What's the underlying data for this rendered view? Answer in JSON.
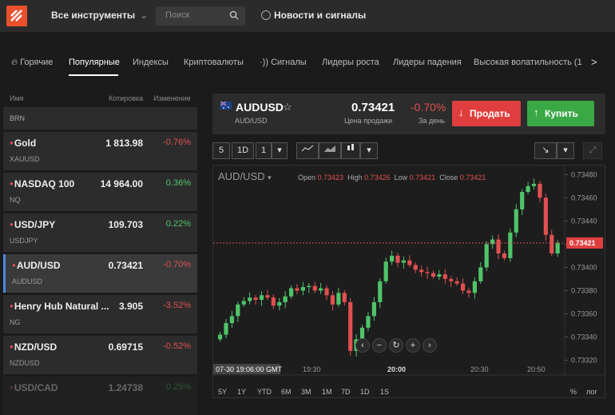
{
  "header": {
    "instruments_label": "Все инструменты",
    "search_placeholder": "Поиск",
    "news_label": "Новости и сигналы"
  },
  "tabs": [
    "Горячие",
    "Популярные",
    "Индексы",
    "Криптовалюты",
    "Сигналы",
    "Лидеры роста",
    "Лидеры падения",
    "Высокая волатильность (1"
  ],
  "list": {
    "col_name": "Имя",
    "col_quote": "Котировка",
    "col_change": "Изменение",
    "items": [
      {
        "name": "BRN",
        "symbol": "",
        "price": "",
        "change": ""
      },
      {
        "name": "Gold",
        "symbol": "XAUUSD",
        "price": "1 813.98",
        "change": "-0.76%"
      },
      {
        "name": "NASDAQ 100",
        "symbol": "NQ",
        "price": "14 964.00",
        "change": "0.36%"
      },
      {
        "name": "USD/JPY",
        "symbol": "USDJPY",
        "price": "109.703",
        "change": "0.22%"
      },
      {
        "name": "AUD/USD",
        "symbol": "AUDUSD",
        "price": "0.73421",
        "change": "-0.70%"
      },
      {
        "name": "Henry Hub Natural ...",
        "symbol": "NG",
        "price": "3.905",
        "change": "-3.52%"
      },
      {
        "name": "NZD/USD",
        "symbol": "NZDUSD",
        "price": "0.69715",
        "change": "-0.52%"
      },
      {
        "name": "USD/CAD",
        "symbol": "",
        "price": "1.24738",
        "change": "0.25%"
      }
    ]
  },
  "panel": {
    "name": "AUDUSD",
    "sub": "AUD/USD",
    "price": "0.73421",
    "price_label": "Цена продажи",
    "change": "-0.70%",
    "change_label": "За день",
    "sell": "Продать",
    "buy": "Купить"
  },
  "controls": {
    "b1": "5",
    "b2": "1D",
    "b3": "1"
  },
  "chart_data": {
    "type": "candlestick",
    "symbol_label": "AUD/USD",
    "ohlc": {
      "open": "0.73423",
      "high": "0.73426",
      "low": "0.73421",
      "close": "0.73421"
    },
    "current_price": "0.73421",
    "y_ticks": [
      "0.73480",
      "0.73460",
      "0.73440",
      "0.73420",
      "0.73400",
      "0.73380",
      "0.73360",
      "0.73340",
      "0.73320"
    ],
    "ylim": [
      0.7331,
      0.73485
    ],
    "x_ticks": [
      "19:30",
      "20:00",
      "20:30",
      "20:50"
    ],
    "cursor_time": "07-30 19:06:00 GMT",
    "closes": [
      0.73342,
      0.73352,
      0.73358,
      0.73368,
      0.73371,
      0.73374,
      0.73372,
      0.73376,
      0.73374,
      0.73367,
      0.7337,
      0.73375,
      0.73382,
      0.7338,
      0.73383,
      0.73384,
      0.7338,
      0.73382,
      0.73376,
      0.73368,
      0.73378,
      0.7337,
      0.73328,
      0.73338,
      0.73348,
      0.73358,
      0.7337,
      0.73388,
      0.73405,
      0.7341,
      0.73404,
      0.73406,
      0.73402,
      0.73398,
      0.73396,
      0.73395,
      0.73392,
      0.73394,
      0.7339,
      0.73388,
      0.73386,
      0.7338,
      0.73378,
      0.73388,
      0.734,
      0.7342,
      0.73424,
      0.73412,
      0.73408,
      0.7343,
      0.7345,
      0.73465,
      0.7347,
      0.73472,
      0.7346,
      0.73428,
      0.73412,
      0.73421
    ]
  },
  "periods": [
    "5Y",
    "1Y",
    "YTD",
    "6M",
    "3M",
    "1M",
    "7D",
    "1D",
    "1S",
    "%",
    "лог"
  ],
  "colors": {
    "up": "#4fc46a",
    "down": "#e05050",
    "accent": "#e8502e",
    "sell": "#e03e3e",
    "buy": "#3aa845"
  }
}
